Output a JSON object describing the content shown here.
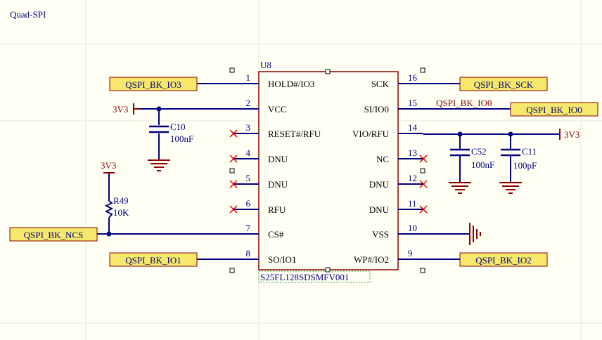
{
  "sheet": {
    "title": "Quad-SPI"
  },
  "chip": {
    "designator": "U8",
    "part_number": "S25FL128SDSMFV001",
    "left_pins": [
      {
        "num": "1",
        "name": "HOLD#/IO3"
      },
      {
        "num": "2",
        "name": "VCC"
      },
      {
        "num": "3",
        "name": "RESET#/RFU"
      },
      {
        "num": "4",
        "name": "DNU"
      },
      {
        "num": "5",
        "name": "DNU"
      },
      {
        "num": "6",
        "name": "RFU"
      },
      {
        "num": "7",
        "name": "CS#"
      },
      {
        "num": "8",
        "name": "SO/IO1"
      }
    ],
    "right_pins": [
      {
        "num": "16",
        "name": "SCK"
      },
      {
        "num": "15",
        "name": "SI/IO0"
      },
      {
        "num": "14",
        "name": "VIO/RFU"
      },
      {
        "num": "13",
        "name": "NC"
      },
      {
        "num": "12",
        "name": "DNU"
      },
      {
        "num": "11",
        "name": "DNU"
      },
      {
        "num": "10",
        "name": "VSS"
      },
      {
        "num": "9",
        "name": "WP#/IO2"
      }
    ]
  },
  "net_ports": {
    "io3": "QSPI_BK_IO3",
    "sck": "QSPI_BK_SCK",
    "io0": "QSPI_BK_IO0",
    "ncs": "QSPI_BK_NCS",
    "io1": "QSPI_BK_IO1",
    "io2": "QSPI_BK_IO2"
  },
  "net_labels": {
    "io0_wire": "QSPI_BK_IO0"
  },
  "power": {
    "left": "3V3",
    "right": "3V3",
    "pullup": "3V3"
  },
  "components": {
    "c10": {
      "designator": "C10",
      "value": "100nF"
    },
    "c52": {
      "designator": "C52",
      "value": "100nF"
    },
    "c11": {
      "designator": "C11",
      "value": "100pF"
    },
    "r49": {
      "designator": "R49",
      "value": "10K"
    }
  },
  "colors": {
    "background": "#fffff4",
    "wire": "#000080",
    "body_fill": "#fffff4",
    "body_stroke": "#8b0000",
    "power": "#8b0000",
    "port_fill": "#f5e86a",
    "port_stroke": "#8b0000",
    "nc_cross": "#d40000",
    "text": "#000080",
    "grid": "#e9e9d8"
  }
}
